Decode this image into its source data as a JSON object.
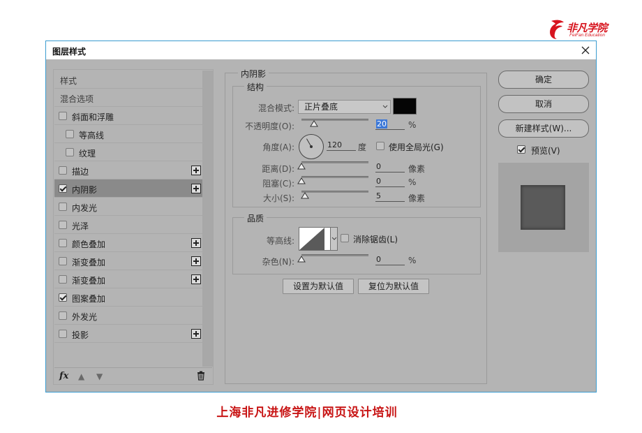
{
  "logo": {
    "text": "非凡学院",
    "sub": "FeiFan Education"
  },
  "dialog": {
    "title": "图层样式",
    "list_header": "样式",
    "blend_options": "混合选项",
    "items": [
      {
        "label": "斜面和浮雕",
        "checked": false,
        "indent": 0,
        "plus": false
      },
      {
        "label": "等高线",
        "checked": false,
        "indent": 1,
        "plus": false
      },
      {
        "label": "纹理",
        "checked": false,
        "indent": 1,
        "plus": false
      },
      {
        "label": "描边",
        "checked": false,
        "indent": 0,
        "plus": true
      },
      {
        "label": "内阴影",
        "checked": true,
        "indent": 0,
        "plus": true,
        "selected": true
      },
      {
        "label": "内发光",
        "checked": false,
        "indent": 0,
        "plus": false
      },
      {
        "label": "光泽",
        "checked": false,
        "indent": 0,
        "plus": false
      },
      {
        "label": "颜色叠加",
        "checked": false,
        "indent": 0,
        "plus": true
      },
      {
        "label": "渐变叠加",
        "checked": false,
        "indent": 0,
        "plus": true
      },
      {
        "label": "渐变叠加",
        "checked": false,
        "indent": 0,
        "plus": true
      },
      {
        "label": "图案叠加",
        "checked": true,
        "indent": 0,
        "plus": false
      },
      {
        "label": "外发光",
        "checked": false,
        "indent": 0,
        "plus": false
      },
      {
        "label": "投影",
        "checked": false,
        "indent": 0,
        "plus": true
      }
    ],
    "footer": {
      "fx": "fx",
      "up_icon": "arrow-up-icon",
      "down_icon": "arrow-down-icon",
      "trash_icon": "trash-icon"
    },
    "section_title": "内阴影",
    "structure": {
      "title": "结构",
      "blend_mode_label": "混合模式:",
      "blend_mode_value": "正片叠底",
      "shadow_color": "#050505",
      "opacity_label": "不透明度(O):",
      "opacity_value": "20",
      "opacity_unit": "%",
      "angle_label": "角度(A):",
      "angle_value": "120",
      "angle_unit": "度",
      "global_light_label": "使用全局光(G)",
      "distance_label": "距离(D):",
      "distance_value": "0",
      "distance_unit": "像素",
      "choke_label": "阻塞(C):",
      "choke_value": "0",
      "choke_unit": "%",
      "size_label": "大小(S):",
      "size_value": "5",
      "size_unit": "像素"
    },
    "quality": {
      "title": "品质",
      "contour_label": "等高线:",
      "anti_alias_label": "消除锯齿(L)",
      "noise_label": "杂色(N):",
      "noise_value": "0",
      "noise_unit": "%"
    },
    "set_default": "设置为默认值",
    "reset_default": "复位为默认值",
    "ok": "确定",
    "cancel": "取消",
    "new_style": "新建样式(W)...",
    "preview_label": "预览(V)"
  },
  "caption": "上海非凡进修学院|网页设计培训"
}
